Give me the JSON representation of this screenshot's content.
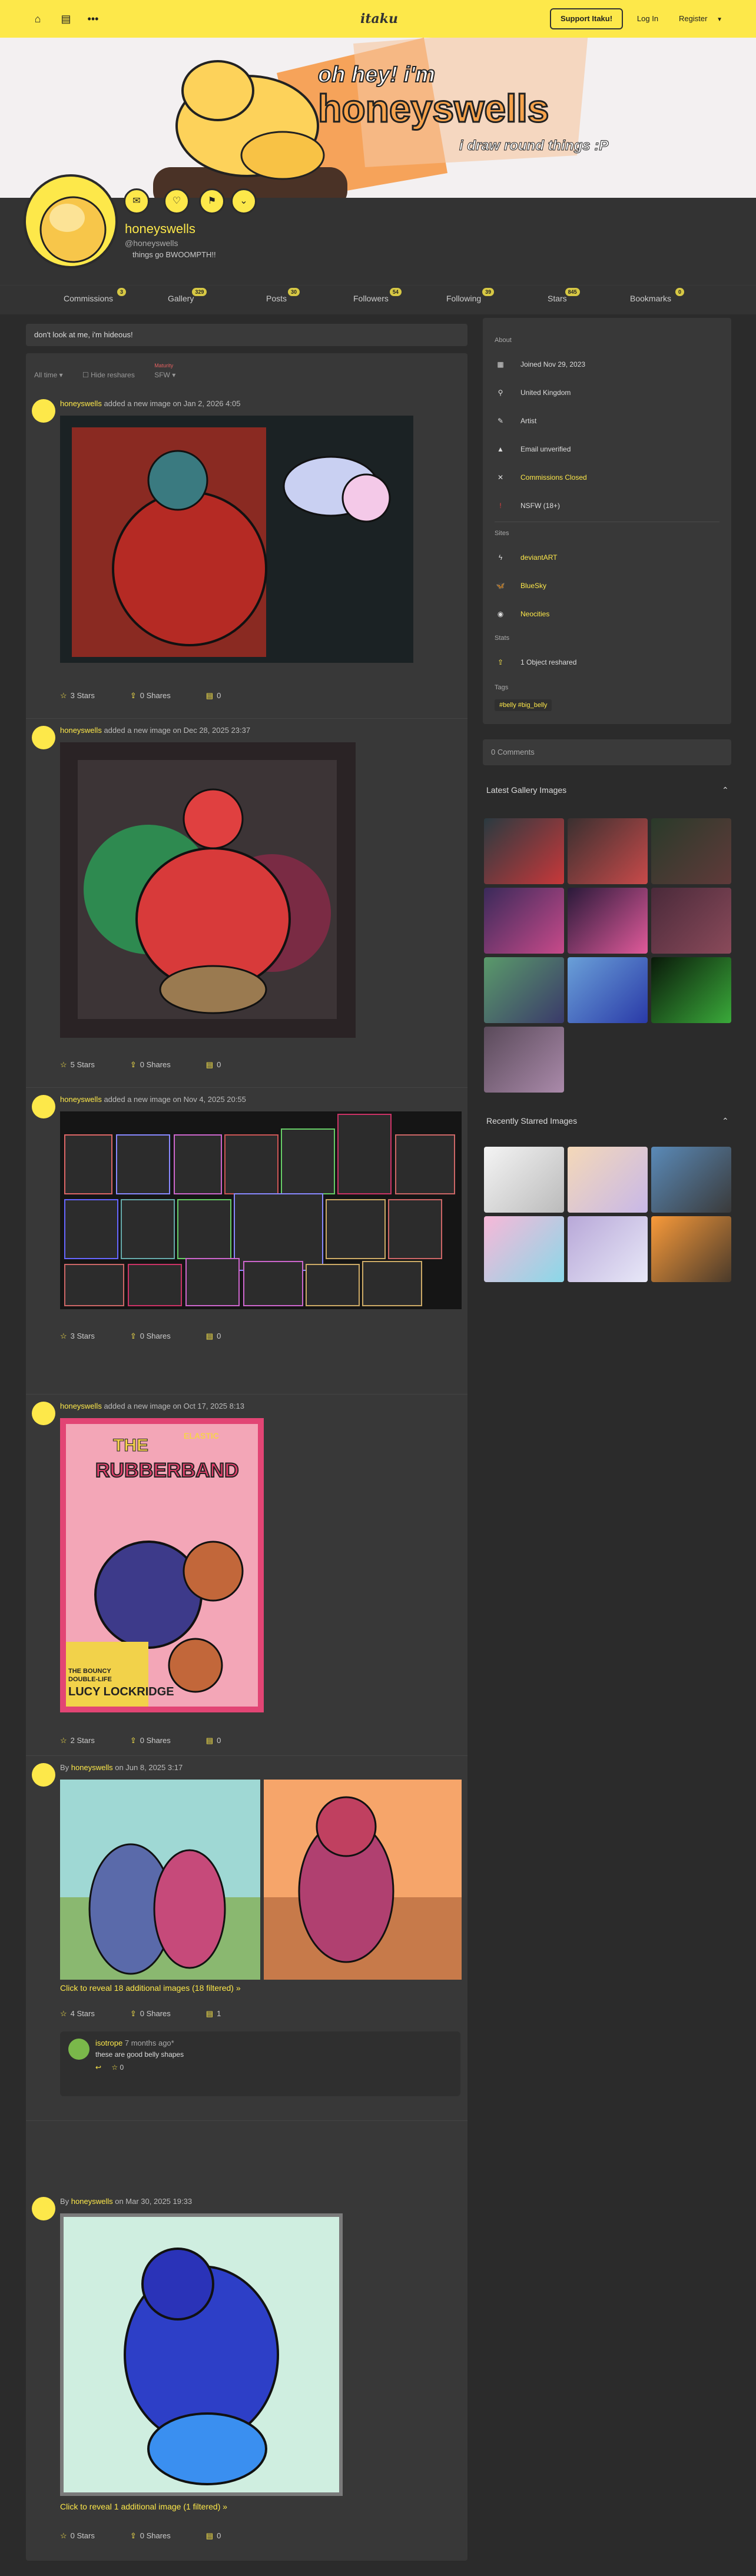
{
  "topbar": {
    "logo": "itaku",
    "support": "Support Itaku!",
    "login": "Log In",
    "register": "Register"
  },
  "banner": {
    "line1": "oh hey! i'm",
    "line2": "honeyswells",
    "line3": "i draw round things :P"
  },
  "profile": {
    "name": "honeyswells",
    "handle": "@honeyswells",
    "desc": " things go BWOOMPTH!!"
  },
  "tabs": [
    {
      "label": "Commissions",
      "count": "3"
    },
    {
      "label": "Gallery",
      "count": "329"
    },
    {
      "label": "Posts",
      "count": "30"
    },
    {
      "label": "Followers",
      "count": "54"
    },
    {
      "label": "Following",
      "count": "39"
    },
    {
      "label": "Stars",
      "count": "845"
    },
    {
      "label": "Bookmarks",
      "count": "0"
    }
  ],
  "bio": "don't look at me, i'm hideous!",
  "filters": {
    "time": "All time",
    "hide": "Hide reshares",
    "maturity": "Maturity",
    "rating": "SFW"
  },
  "posts": [
    {
      "user": "honeyswells",
      "action": " added a new image on Jan 2, 2026 4:05",
      "stars": "3 Stars",
      "shares": "0 Shares",
      "comments": "0"
    },
    {
      "user": "honeyswells",
      "action": " added a new image on Dec 28, 2025 23:37",
      "stars": "5 Stars",
      "shares": "0 Shares",
      "comments": "0"
    },
    {
      "user": "honeyswells",
      "action": " added a new image on Nov 4, 2025 20:55",
      "stars": "3 Stars",
      "shares": "0 Shares",
      "comments": "0"
    },
    {
      "user": "honeyswells",
      "action": " added a new image on Oct 17, 2025 8:13",
      "stars": "2 Stars",
      "shares": "0 Shares",
      "comments": "0"
    },
    {
      "by": "By ",
      "user": "honeyswells",
      "action": " on Jun 8, 2025 3:17",
      "reveal": "Click to reveal 18 additional images (18 filtered) »",
      "stars": "4 Stars",
      "shares": "0 Shares",
      "comments": "1"
    },
    {
      "by": "By ",
      "user": "honeyswells",
      "action": " on Mar 30, 2025 19:33",
      "reveal": "Click to reveal 1 additional image (1 filtered) »",
      "stars": "0 Stars",
      "shares": "0 Shares",
      "comments": "0"
    }
  ],
  "comment": {
    "user": "isotrope",
    "time": "7 months ago*",
    "text": "these are good belly shapes",
    "count": "0"
  },
  "comic": {
    "title1": "THE",
    "title2": "ELASTIC",
    "title3": "RUBBERBAND",
    "sub1": "THE BOUNCY",
    "sub2": "DOUBLE-LIFE",
    "sub3": "LUCY LOCKRIDGE"
  },
  "about": {
    "title": "About",
    "joined": "Joined Nov 29, 2023",
    "location": "United Kingdom",
    "role": "Artist",
    "email": "Email unverified",
    "commissions": "Commissions Closed",
    "nsfw": "NSFW (18+)",
    "sites_title": "Sites",
    "sites": [
      "deviantART",
      "BlueSky",
      "Neocities"
    ],
    "stats_title": "Stats",
    "reshared": "1 Object reshared",
    "tags_title": "Tags",
    "tags": "#belly #big_belly"
  },
  "comments_box": "0 Comments",
  "latest_title": "Latest Gallery Images",
  "starred_title": "Recently Starred Images",
  "colors": {
    "accent": "#fde84a",
    "bg": "#2b2b2b",
    "panel": "#383838"
  }
}
